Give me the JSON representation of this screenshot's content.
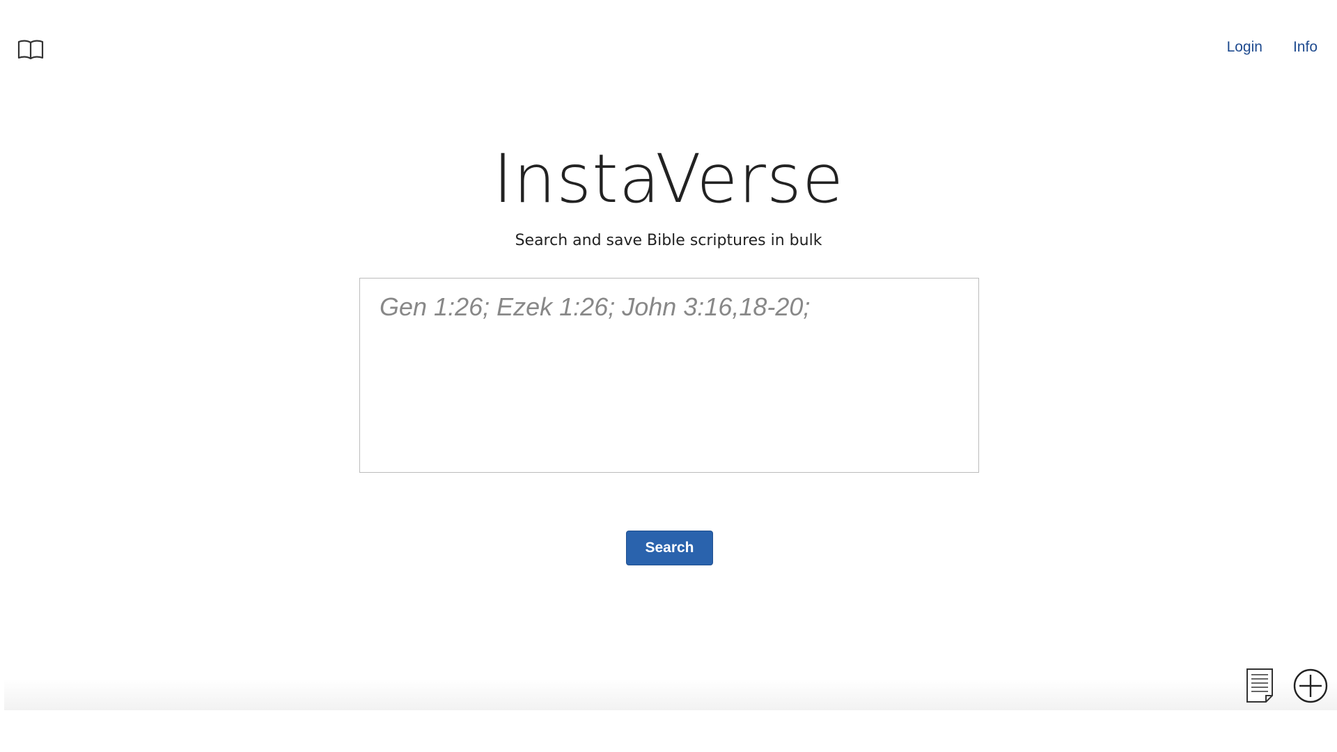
{
  "header": {
    "logo_icon": "open-book-icon",
    "nav": {
      "login_label": "Login",
      "info_label": "Info"
    },
    "link_color": "#1f4b8f"
  },
  "hero": {
    "title": "InstaVerse",
    "subtitle": "Search and save Bible scriptures in bulk"
  },
  "search": {
    "input_value": "",
    "placeholder": "Gen 1:26; Ezek 1:26; John 3:16,18-20;",
    "button_label": "Search",
    "button_color": "#2a63ad"
  },
  "footer": {
    "icons": [
      "notes-icon",
      "add-circle-icon"
    ]
  }
}
